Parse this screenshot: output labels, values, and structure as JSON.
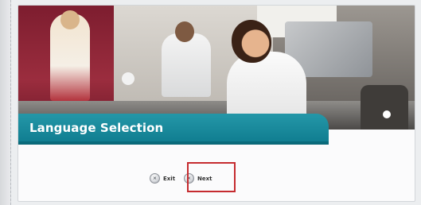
{
  "header": {
    "title": "Language Selection"
  },
  "buttons": {
    "exit_label": "Exit",
    "next_label": "Next",
    "icon_glyph": "×"
  },
  "colors": {
    "title_band": "#1a8a9c",
    "highlight": "#c52b2f"
  },
  "icons": {
    "exit": "close-circle-icon",
    "next": "close-circle-icon"
  }
}
